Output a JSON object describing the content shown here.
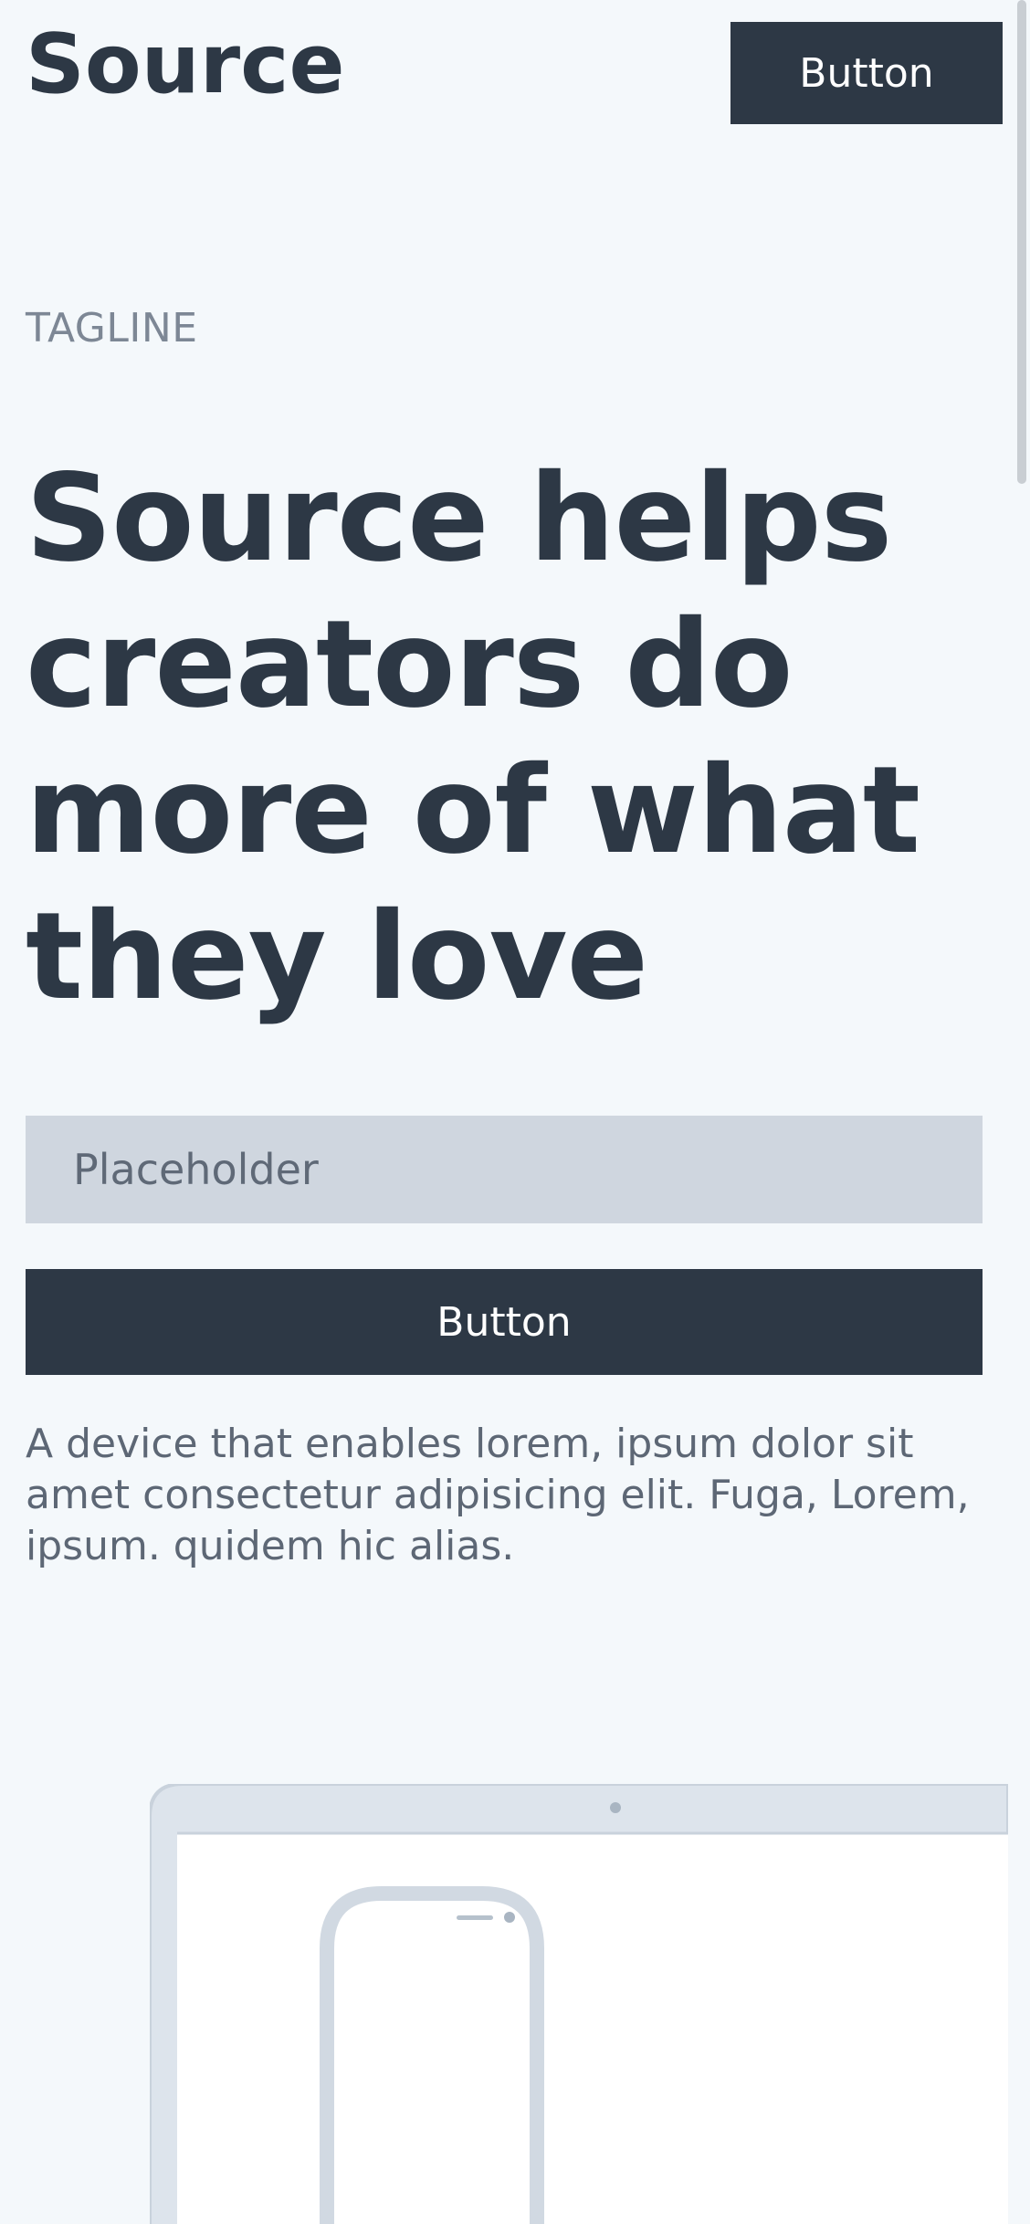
{
  "header": {
    "brand": "Source",
    "button_label": "Button"
  },
  "hero": {
    "tagline": "TAGLINE",
    "headline": "Source helps creators do more of what they love",
    "input_placeholder": "Placeholder",
    "cta_label": "Button",
    "description": "A device that enables lorem, ipsum dolor sit amet consectetur adipisicing elit. Fuga, Lorem, ipsum. quidem hic alias."
  },
  "colors": {
    "background": "#f4f8fb",
    "primary": "#2d3845",
    "input_bg": "#cfd6df",
    "muted_text": "#7d8795",
    "device_frame": "#dde4ec"
  },
  "icons": {
    "laptop": "laptop-mockup-icon",
    "phone": "phone-mockup-icon"
  }
}
